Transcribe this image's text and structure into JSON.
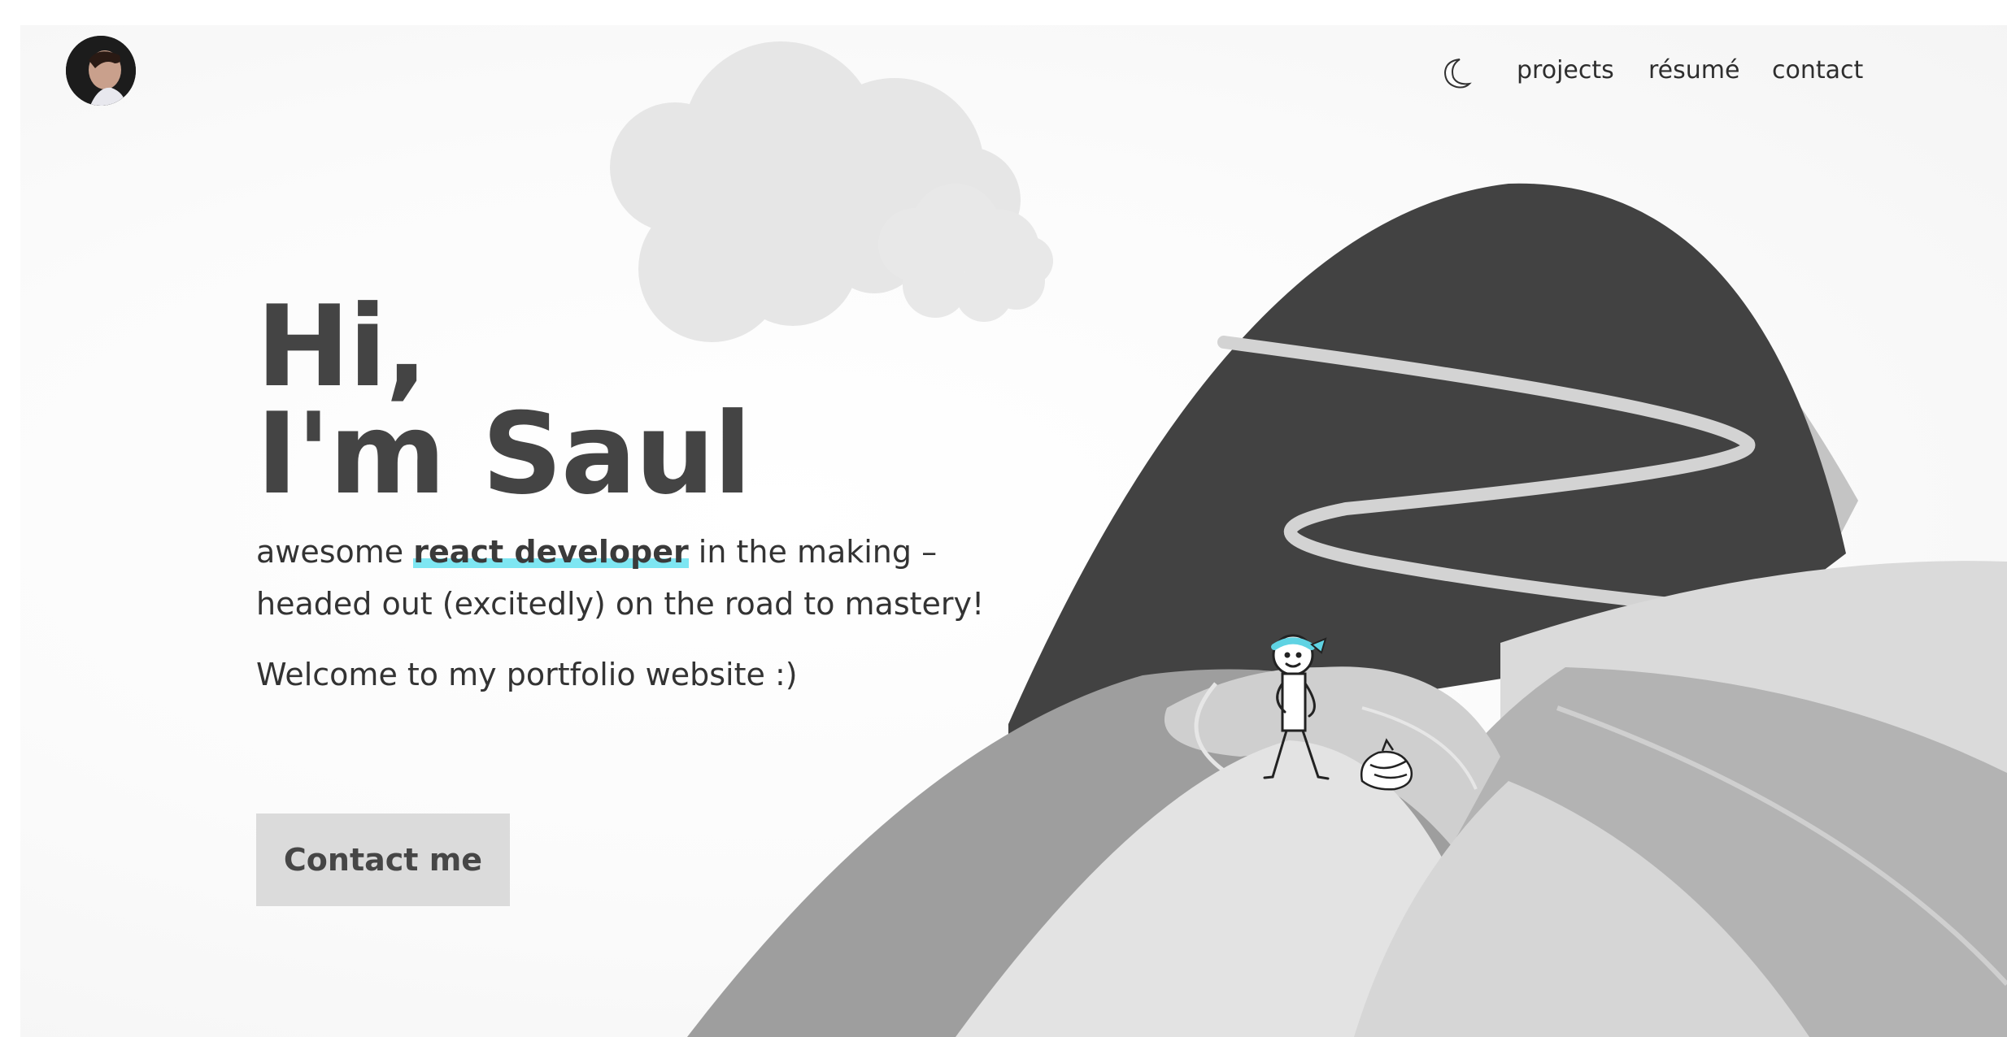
{
  "header": {
    "avatar_alt": "Saul",
    "nav": {
      "theme_toggle_icon": "moon-icon",
      "links": [
        "projects",
        "résumé",
        "contact"
      ]
    }
  },
  "hero": {
    "headline_line1": "Hi,",
    "headline_line2": "I'm Saul",
    "tagline_prefix": "awesome ",
    "tagline_highlight": "react developer",
    "tagline_suffix": " in the making –",
    "tagline_line2": "headed out (excitedly) on the road to mastery!",
    "welcome": "Welcome to my portfolio website :)",
    "cta_label": "Contact me"
  },
  "colors": {
    "accent": "#7ee6f2",
    "text_dark": "#444444",
    "mountain_dark": "#424242",
    "hill_mid": "#9e9e9e",
    "hill_light": "#e0e0e0",
    "cloud": "#e6e6e6",
    "button_bg": "#dbdbdb"
  },
  "illustration": {
    "subject": "stick figure with cyan headband standing on hills beside a bundle, winding road up a dark mountain, clouds"
  }
}
